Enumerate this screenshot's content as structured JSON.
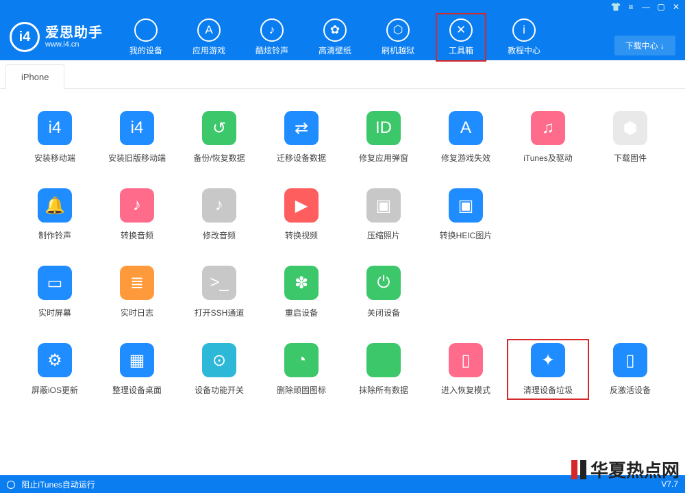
{
  "brand": {
    "logo_text": "i4",
    "title": "爱思助手",
    "subtitle": "www.i4.cn"
  },
  "download_center": "下载中心 ↓",
  "nav": [
    {
      "label": "我的设备",
      "glyph": ""
    },
    {
      "label": "应用游戏",
      "glyph": "A"
    },
    {
      "label": "酷炫铃声",
      "glyph": "♪"
    },
    {
      "label": "高清壁纸",
      "glyph": "✿"
    },
    {
      "label": "刷机越狱",
      "glyph": "⬡"
    },
    {
      "label": "工具箱",
      "glyph": "✕",
      "active": true
    },
    {
      "label": "教程中心",
      "glyph": "i"
    }
  ],
  "tab": "iPhone",
  "rows": [
    [
      {
        "label": "安装移动端",
        "glyph": "i4",
        "color": "c-blue"
      },
      {
        "label": "安装旧版移动端",
        "glyph": "i4",
        "color": "c-blue"
      },
      {
        "label": "备份/恢复数据",
        "glyph": "↺",
        "color": "c-green"
      },
      {
        "label": "迁移设备数据",
        "glyph": "⇄",
        "color": "c-blue"
      },
      {
        "label": "修复应用弹窗",
        "glyph": "ID",
        "color": "c-green"
      },
      {
        "label": "修复游戏失效",
        "glyph": "A",
        "color": "c-blue"
      },
      {
        "label": "iTunes及驱动",
        "glyph": "♫",
        "color": "c-pink"
      },
      {
        "label": "下载固件",
        "glyph": "⬢",
        "color": "c-grey",
        "muted": true
      }
    ],
    [
      {
        "label": "制作铃声",
        "glyph": "🔔",
        "color": "c-blue"
      },
      {
        "label": "转换音频",
        "glyph": "♪",
        "color": "c-pink"
      },
      {
        "label": "修改音频",
        "glyph": "♪",
        "color": "c-grey"
      },
      {
        "label": "转换视频",
        "glyph": "▶",
        "color": "c-red"
      },
      {
        "label": "压缩照片",
        "glyph": "▣",
        "color": "c-grey"
      },
      {
        "label": "转换HEIC图片",
        "glyph": "▣",
        "color": "c-blue"
      }
    ],
    [
      {
        "label": "实时屏幕",
        "glyph": "▭",
        "color": "c-blue"
      },
      {
        "label": "实时日志",
        "glyph": "≣",
        "color": "c-orange"
      },
      {
        "label": "打开SSH通道",
        "glyph": ">_",
        "color": "c-grey"
      },
      {
        "label": "重启设备",
        "glyph": "✽",
        "color": "c-green"
      },
      {
        "label": "关闭设备",
        "glyph": "⏻",
        "color": "c-green"
      }
    ],
    [
      {
        "label": "屏蔽iOS更新",
        "glyph": "⚙",
        "color": "c-blue"
      },
      {
        "label": "整理设备桌面",
        "glyph": "▦",
        "color": "c-blue"
      },
      {
        "label": "设备功能开关",
        "glyph": "⊙",
        "color": "c-cyan"
      },
      {
        "label": "删除顽固图标",
        "glyph": "◔",
        "color": "c-green"
      },
      {
        "label": "抹除所有数据",
        "glyph": "",
        "color": "c-green"
      },
      {
        "label": "进入恢复模式",
        "glyph": "▯",
        "color": "c-pink"
      },
      {
        "label": "清理设备垃圾",
        "glyph": "✦",
        "color": "c-blue",
        "highlight": true
      },
      {
        "label": "反激活设备",
        "glyph": "▯",
        "color": "c-blue"
      }
    ]
  ],
  "footer": {
    "checkbox_label": "阻止iTunes自动运行",
    "version": "V7.7"
  },
  "watermark": "华夏热点网"
}
